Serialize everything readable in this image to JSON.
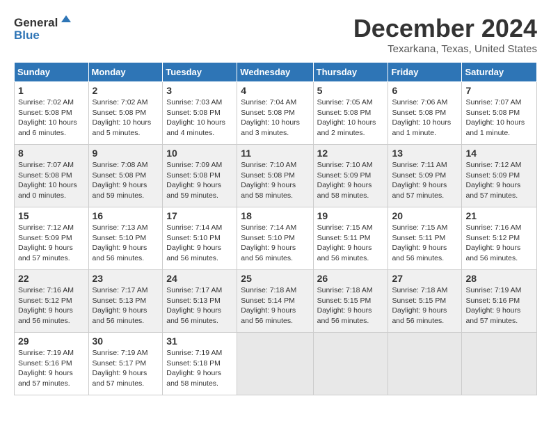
{
  "header": {
    "logo_line1": "General",
    "logo_line2": "Blue",
    "month": "December 2024",
    "location": "Texarkana, Texas, United States"
  },
  "days_of_week": [
    "Sunday",
    "Monday",
    "Tuesday",
    "Wednesday",
    "Thursday",
    "Friday",
    "Saturday"
  ],
  "weeks": [
    [
      {
        "day": "1",
        "sunrise": "7:02 AM",
        "sunset": "5:08 PM",
        "daylight": "10 hours and 6 minutes."
      },
      {
        "day": "2",
        "sunrise": "7:02 AM",
        "sunset": "5:08 PM",
        "daylight": "10 hours and 5 minutes."
      },
      {
        "day": "3",
        "sunrise": "7:03 AM",
        "sunset": "5:08 PM",
        "daylight": "10 hours and 4 minutes."
      },
      {
        "day": "4",
        "sunrise": "7:04 AM",
        "sunset": "5:08 PM",
        "daylight": "10 hours and 3 minutes."
      },
      {
        "day": "5",
        "sunrise": "7:05 AM",
        "sunset": "5:08 PM",
        "daylight": "10 hours and 2 minutes."
      },
      {
        "day": "6",
        "sunrise": "7:06 AM",
        "sunset": "5:08 PM",
        "daylight": "10 hours and 1 minute."
      },
      {
        "day": "7",
        "sunrise": "7:07 AM",
        "sunset": "5:08 PM",
        "daylight": "10 hours and 1 minute."
      }
    ],
    [
      {
        "day": "8",
        "sunrise": "7:07 AM",
        "sunset": "5:08 PM",
        "daylight": "10 hours and 0 minutes."
      },
      {
        "day": "9",
        "sunrise": "7:08 AM",
        "sunset": "5:08 PM",
        "daylight": "9 hours and 59 minutes."
      },
      {
        "day": "10",
        "sunrise": "7:09 AM",
        "sunset": "5:08 PM",
        "daylight": "9 hours and 59 minutes."
      },
      {
        "day": "11",
        "sunrise": "7:10 AM",
        "sunset": "5:08 PM",
        "daylight": "9 hours and 58 minutes."
      },
      {
        "day": "12",
        "sunrise": "7:10 AM",
        "sunset": "5:09 PM",
        "daylight": "9 hours and 58 minutes."
      },
      {
        "day": "13",
        "sunrise": "7:11 AM",
        "sunset": "5:09 PM",
        "daylight": "9 hours and 57 minutes."
      },
      {
        "day": "14",
        "sunrise": "7:12 AM",
        "sunset": "5:09 PM",
        "daylight": "9 hours and 57 minutes."
      }
    ],
    [
      {
        "day": "15",
        "sunrise": "7:12 AM",
        "sunset": "5:09 PM",
        "daylight": "9 hours and 57 minutes."
      },
      {
        "day": "16",
        "sunrise": "7:13 AM",
        "sunset": "5:10 PM",
        "daylight": "9 hours and 56 minutes."
      },
      {
        "day": "17",
        "sunrise": "7:14 AM",
        "sunset": "5:10 PM",
        "daylight": "9 hours and 56 minutes."
      },
      {
        "day": "18",
        "sunrise": "7:14 AM",
        "sunset": "5:10 PM",
        "daylight": "9 hours and 56 minutes."
      },
      {
        "day": "19",
        "sunrise": "7:15 AM",
        "sunset": "5:11 PM",
        "daylight": "9 hours and 56 minutes."
      },
      {
        "day": "20",
        "sunrise": "7:15 AM",
        "sunset": "5:11 PM",
        "daylight": "9 hours and 56 minutes."
      },
      {
        "day": "21",
        "sunrise": "7:16 AM",
        "sunset": "5:12 PM",
        "daylight": "9 hours and 56 minutes."
      }
    ],
    [
      {
        "day": "22",
        "sunrise": "7:16 AM",
        "sunset": "5:12 PM",
        "daylight": "9 hours and 56 minutes."
      },
      {
        "day": "23",
        "sunrise": "7:17 AM",
        "sunset": "5:13 PM",
        "daylight": "9 hours and 56 minutes."
      },
      {
        "day": "24",
        "sunrise": "7:17 AM",
        "sunset": "5:13 PM",
        "daylight": "9 hours and 56 minutes."
      },
      {
        "day": "25",
        "sunrise": "7:18 AM",
        "sunset": "5:14 PM",
        "daylight": "9 hours and 56 minutes."
      },
      {
        "day": "26",
        "sunrise": "7:18 AM",
        "sunset": "5:15 PM",
        "daylight": "9 hours and 56 minutes."
      },
      {
        "day": "27",
        "sunrise": "7:18 AM",
        "sunset": "5:15 PM",
        "daylight": "9 hours and 56 minutes."
      },
      {
        "day": "28",
        "sunrise": "7:19 AM",
        "sunset": "5:16 PM",
        "daylight": "9 hours and 57 minutes."
      }
    ],
    [
      {
        "day": "29",
        "sunrise": "7:19 AM",
        "sunset": "5:16 PM",
        "daylight": "9 hours and 57 minutes."
      },
      {
        "day": "30",
        "sunrise": "7:19 AM",
        "sunset": "5:17 PM",
        "daylight": "9 hours and 57 minutes."
      },
      {
        "day": "31",
        "sunrise": "7:19 AM",
        "sunset": "5:18 PM",
        "daylight": "9 hours and 58 minutes."
      },
      null,
      null,
      null,
      null
    ]
  ],
  "labels": {
    "sunrise": "Sunrise:",
    "sunset": "Sunset:",
    "daylight": "Daylight:"
  }
}
